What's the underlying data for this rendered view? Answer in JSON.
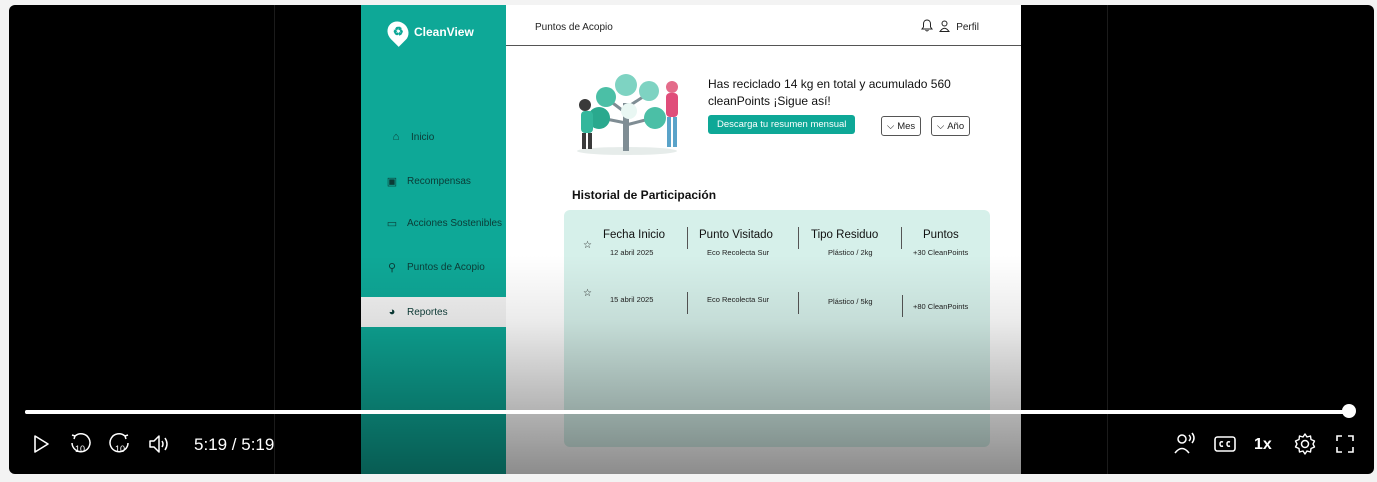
{
  "app": {
    "name": "CleanView",
    "breadcrumb": "Puntos de Acopio",
    "profile_label": "Perfil"
  },
  "sidebar": {
    "items": [
      {
        "label": "Inicio",
        "icon": "home-icon"
      },
      {
        "label": "Recompensas",
        "icon": "gift-icon"
      },
      {
        "label": "Acciones Sostenibles",
        "icon": "folder-icon"
      },
      {
        "label": "Puntos de Acopio",
        "icon": "pin-icon"
      },
      {
        "label": "Reportes",
        "icon": "chart-pie-icon",
        "active": true
      }
    ]
  },
  "summary": {
    "message": "Has reciclado 14 kg en total y acumulado 560 cleanPoints ¡Sigue así!",
    "button_label": "Descarga tu resumen mensual",
    "filter_month": "Mes",
    "filter_year": "Año"
  },
  "history": {
    "title": "Historial de Participación",
    "columns": [
      "Fecha Inicio",
      "Punto Visitado",
      "Tipo Residuo",
      "Puntos"
    ],
    "rows": [
      {
        "date": "12 abril 2025",
        "place": "Eco Recolecta Sur",
        "waste": "Plástico / 2kg",
        "points": "+30 CleanPoints"
      },
      {
        "date": "15 abril 2025",
        "place": "Eco Recolecta Sur",
        "waste": "Plástico / 5kg",
        "points": "+80 CleanPoints"
      }
    ]
  },
  "player": {
    "time_label": "5:19 / 5:19",
    "progress_fraction": 1.0,
    "playback_rate": "1x",
    "skip_back_seconds": "10",
    "skip_forward_seconds": "10"
  },
  "colors": {
    "brand_teal": "#0ea897",
    "table_bg": "#d6f0ea"
  }
}
